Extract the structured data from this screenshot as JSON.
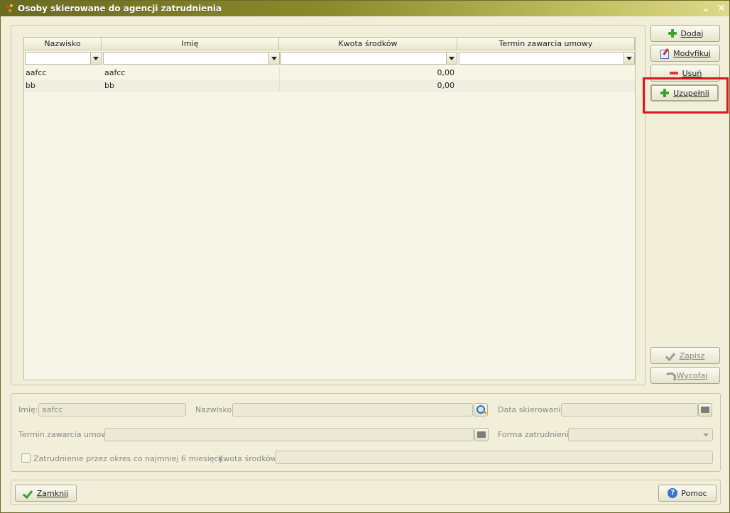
{
  "window": {
    "title": "Osoby skierowane do agencji zatrudnienia"
  },
  "grid": {
    "columns": [
      "Nazwisko",
      "Imię",
      "Kwota środków",
      "Termin zawarcia umowy"
    ],
    "rows": [
      [
        "aafcc",
        "aafcc",
        "0,00",
        ""
      ],
      [
        "bb",
        "bb",
        "0,00",
        ""
      ]
    ]
  },
  "actions": {
    "dodaj": "Dodaj",
    "modyfikuj": "Modyfikuj",
    "usun": "Usuń",
    "uzupelnij": "Uzupełnij",
    "zapisz": "Zapisz",
    "wycofaj": "Wycofaj"
  },
  "details": {
    "imie_label": "Imię:",
    "imie_value": "aafcc",
    "nazwisko_label": "Nazwisko:",
    "nazwisko_value": "",
    "data_skierowania_label": "Data skierowania:",
    "termin_label": "Termin zawarcia umowy:",
    "forma_label": "Forma zatrudnienia:",
    "zatrudnienie_checkbox_label": "Zatrudnienie przez okres co najmniej 6 miesięcy",
    "kwota_label": "Kwota środków:"
  },
  "footer": {
    "zamknij": "Zamknij",
    "pomoc": "Pomoc"
  },
  "colors": {
    "titlebar_start": "#6b6b1e",
    "titlebar_end": "#dcd98a",
    "highlight": "#d8181d",
    "background": "#f1efd9"
  }
}
